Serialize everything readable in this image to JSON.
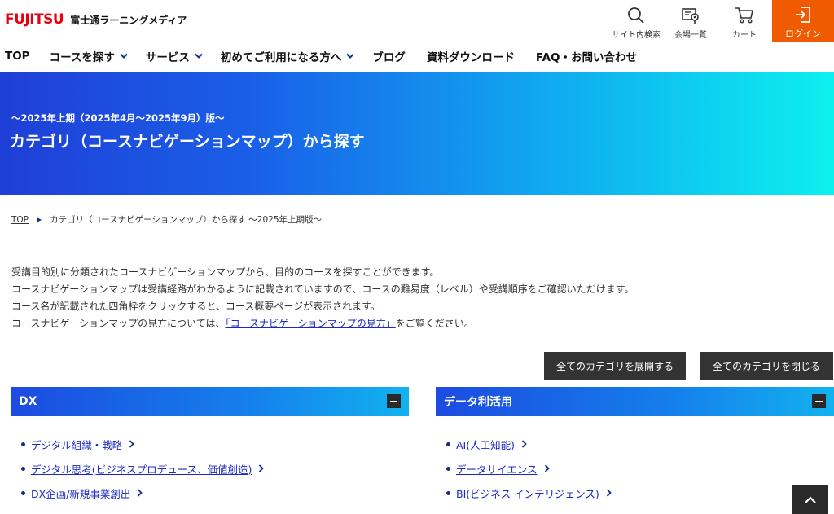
{
  "header": {
    "logo_mark": "FUJITSU",
    "logo_text": "富士通ラーニングメディア",
    "search_label": "サイト内検索",
    "venue_label": "会場一覧",
    "cart_label": "カート",
    "login_label": "ログイン",
    "icons": {
      "search": "search-icon",
      "venue": "map-pin-icon",
      "cart": "cart-icon",
      "login": "login-icon"
    },
    "login_color": "#f05a00"
  },
  "nav": {
    "items": [
      {
        "label": "TOP"
      },
      {
        "label": "コースを探す"
      },
      {
        "label": "サービス"
      },
      {
        "label": "初めてご利用になる方へ"
      },
      {
        "label": "ブログ"
      },
      {
        "label": "資料ダウンロード"
      },
      {
        "label": "FAQ・お問い合わせ"
      }
    ]
  },
  "hero": {
    "subtitle": "～2025年上期（2025年4月～2025年9月）版～",
    "title": "カテゴリ（コースナビゲーションマップ）から探す"
  },
  "breadcrumb": {
    "home": "TOP",
    "current": "カテゴリ（コースナビゲーションマップ）から探す ～2025年上期版～"
  },
  "intro": {
    "line1": "受講目的別に分類されたコースナビゲーションマップから、目的のコースを探すことができます。",
    "line2": "コースナビゲーションマップは受講経路がわかるように記載されていますので、コースの難易度（レベル）や受講順序をご確認いただけます。",
    "line3": "コース名が記載された四角枠をクリックすると、コース概要ページが表示されます。",
    "line4_pre": "コースナビゲーションマップの見方については、",
    "line4_link": "「コースナビゲーションマップの見方」",
    "line4_post": "をご覧ください。"
  },
  "actions": {
    "expand_all": "全てのカテゴリを展開する",
    "collapse_all": "全てのカテゴリを閉じる"
  },
  "categories": [
    {
      "title": "DX",
      "items": [
        {
          "label": "デジタル組織・戦略"
        },
        {
          "label": "デジタル思考(ビジネスプロデュース、価値創造)"
        },
        {
          "label": "DX企画/新規事業創出"
        }
      ]
    },
    {
      "title": "データ利活用",
      "items": [
        {
          "label": "AI(人工知能)"
        },
        {
          "label": "データサイエンス"
        },
        {
          "label": "BI(ビジネス インテリジェンス)"
        }
      ]
    }
  ]
}
